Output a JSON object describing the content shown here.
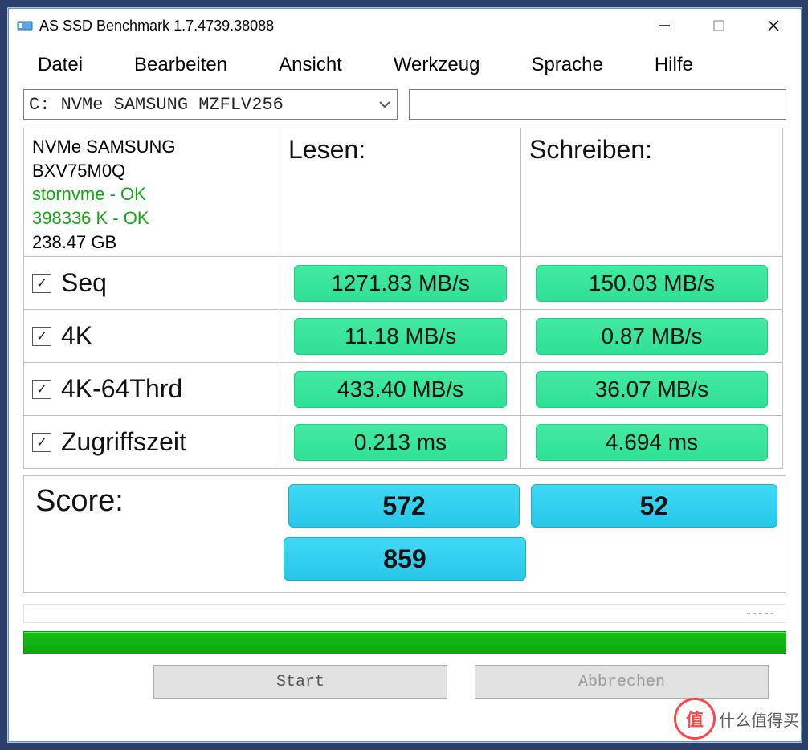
{
  "window": {
    "title": "AS SSD Benchmark 1.7.4739.38088"
  },
  "menu": {
    "datei": "Datei",
    "bearbeiten": "Bearbeiten",
    "ansicht": "Ansicht",
    "werkzeug": "Werkzeug",
    "sprache": "Sprache",
    "hilfe": "Hilfe"
  },
  "drive_selector": "C: NVMe SAMSUNG MZFLV256",
  "device": {
    "name": "NVMe SAMSUNG",
    "firmware": "BXV75M0Q",
    "driver_status": "stornvme - OK",
    "alignment_status": "398336 K - OK",
    "capacity": "238.47 GB"
  },
  "headers": {
    "read": "Lesen:",
    "write": "Schreiben:"
  },
  "tests": [
    {
      "label": "Seq",
      "checked": true,
      "read": "1271.83 MB/s",
      "write": "150.03 MB/s"
    },
    {
      "label": "4K",
      "checked": true,
      "read": "11.18 MB/s",
      "write": "0.87 MB/s"
    },
    {
      "label": "4K-64Thrd",
      "checked": true,
      "read": "433.40 MB/s",
      "write": "36.07 MB/s"
    },
    {
      "label": "Zugriffszeit",
      "checked": true,
      "read": "0.213 ms",
      "write": "4.694 ms"
    }
  ],
  "score": {
    "label": "Score:",
    "read": "572",
    "write": "52",
    "total": "859"
  },
  "status_dashes": "-----",
  "buttons": {
    "start": "Start",
    "cancel": "Abbrechen"
  },
  "watermark": {
    "icon_text": "值",
    "text": "什么值得买"
  },
  "colors": {
    "green_pill": "#2ee096",
    "blue_pill": "#28c7e8",
    "progress": "#0ea80e"
  }
}
